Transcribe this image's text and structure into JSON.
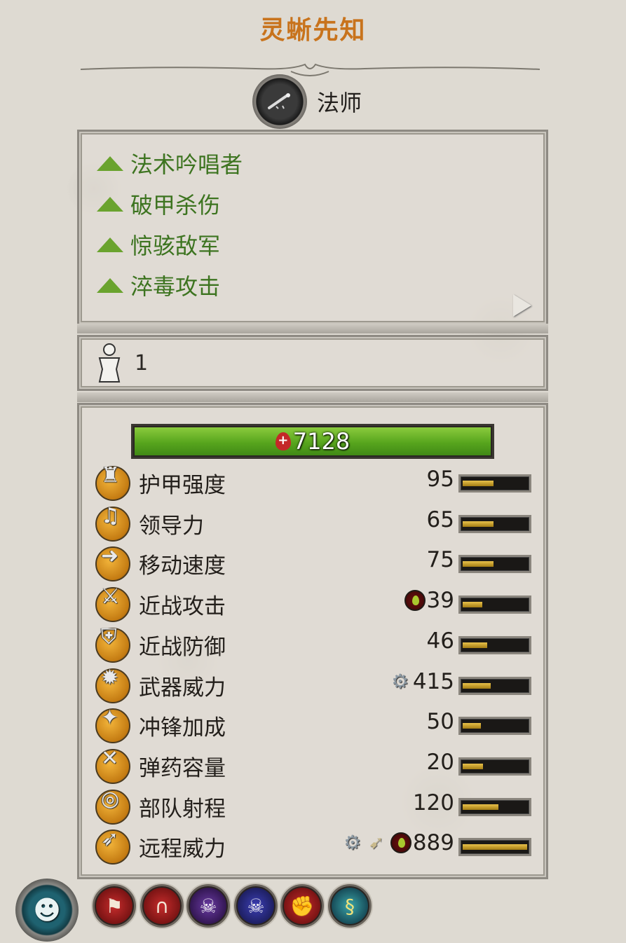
{
  "unit": {
    "name": "灵蜥先知",
    "class_label": "法师",
    "class_icon": "mage-staff-icon"
  },
  "abilities": [
    {
      "label": "法术吟唱者",
      "icon": "green-triangle-icon"
    },
    {
      "label": "破甲杀伤",
      "icon": "green-triangle-icon"
    },
    {
      "label": "惊骇敌军",
      "icon": "green-triangle-icon"
    },
    {
      "label": "淬毒攻击",
      "icon": "green-triangle-icon"
    }
  ],
  "entity_count": "1",
  "health": {
    "value": "7128",
    "fill_fraction": 1.0
  },
  "stats": [
    {
      "label": "护甲强度",
      "value": "95",
      "icon": "armor-icon",
      "bar_fraction": 0.48,
      "modifiers": []
    },
    {
      "label": "领导力",
      "value": "65",
      "icon": "leadership-horn-icon",
      "bar_fraction": 0.48,
      "modifiers": []
    },
    {
      "label": "移动速度",
      "value": "75",
      "icon": "speed-arrow-icon",
      "bar_fraction": 0.48,
      "modifiers": []
    },
    {
      "label": "近战攻击",
      "value": "39",
      "icon": "melee-attack-sword-icon",
      "bar_fraction": 0.3,
      "modifiers": [
        "poison-icon"
      ]
    },
    {
      "label": "近战防御",
      "value": "46",
      "icon": "melee-defence-shield-icon",
      "bar_fraction": 0.38,
      "modifiers": []
    },
    {
      "label": "武器威力",
      "value": "415",
      "icon": "weapon-strength-icon",
      "bar_fraction": 0.44,
      "modifiers": [
        "armour-piercing-icon"
      ]
    },
    {
      "label": "冲锋加成",
      "value": "50",
      "icon": "charge-bonus-icon",
      "bar_fraction": 0.28,
      "modifiers": []
    },
    {
      "label": "弹药容量",
      "value": "20",
      "icon": "ammunition-icon",
      "bar_fraction": 0.32,
      "modifiers": []
    },
    {
      "label": "部队射程",
      "value": "120",
      "icon": "range-target-icon",
      "bar_fraction": 0.55,
      "modifiers": []
    },
    {
      "label": "远程威力",
      "value": "889",
      "icon": "missile-strength-icon",
      "bar_fraction": 1.0,
      "modifiers": [
        "armour-piercing-icon",
        "ranged-arrow-icon",
        "poison-icon"
      ]
    }
  ],
  "attribute_icons": [
    "faction-red-banner-icon",
    "fire-gate-icon",
    "purple-skull-icon",
    "blue-skull-icon",
    "red-fist-icon",
    "lizard-spirit-icon"
  ],
  "colors": {
    "title": "#c8731c",
    "ability_text": "#3d7420",
    "health_bar": "#57a51d",
    "stat_bar_fill": "#d2a532"
  }
}
